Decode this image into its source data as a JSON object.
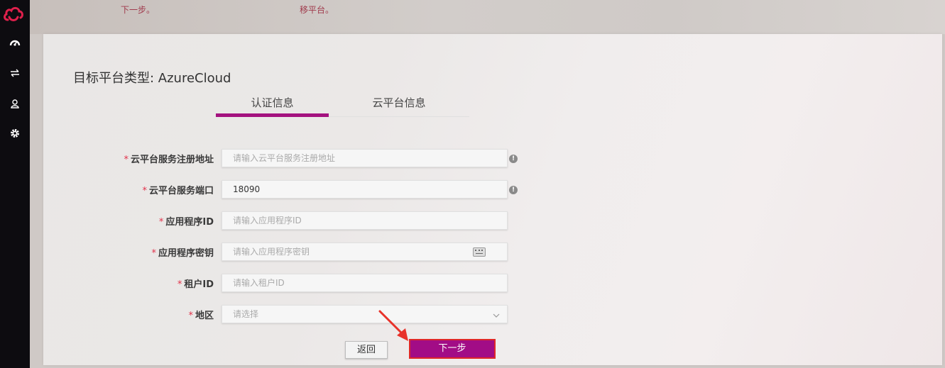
{
  "colors": {
    "accent": "#a20c86",
    "required": "#e2324a",
    "sidebar": "#0d0c10"
  },
  "sidebar": {
    "items": [
      {
        "icon": "dashboard-icon"
      },
      {
        "icon": "transfer-icon"
      },
      {
        "icon": "user-icon"
      },
      {
        "icon": "gear-icon"
      }
    ]
  },
  "top_steps": [
    "下一步。",
    "移平台。"
  ],
  "page": {
    "title": "目标平台类型: AzureCloud"
  },
  "tabs": [
    {
      "label": "认证信息",
      "active": true
    },
    {
      "label": "云平台信息",
      "active": false
    }
  ],
  "form": {
    "fields": [
      {
        "label": "云平台服务注册地址",
        "placeholder": "请输入云平台服务注册地址",
        "value": ""
      },
      {
        "label": "云平台服务端口",
        "placeholder": "",
        "value": "18090"
      },
      {
        "label": "应用程序ID",
        "placeholder": "请输入应用程序ID",
        "value": ""
      },
      {
        "label": "应用程序密钥",
        "placeholder": "请输入应用程序密钥",
        "value": ""
      },
      {
        "label": "租户ID",
        "placeholder": "请输入租户ID",
        "value": ""
      },
      {
        "label": "地区",
        "placeholder": "请选择",
        "value": ""
      }
    ]
  },
  "buttons": {
    "back": "返回",
    "next": "下一步"
  }
}
